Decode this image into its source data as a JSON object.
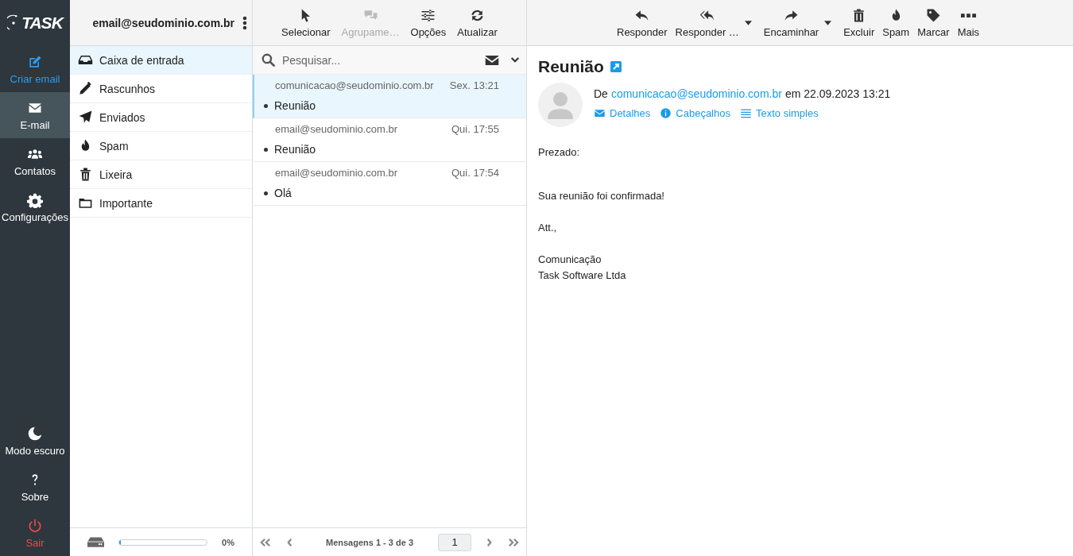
{
  "logo": "TASK",
  "nav": {
    "top": [
      {
        "kind": "compose",
        "label": "Criar email",
        "selected": false
      },
      {
        "kind": "mail",
        "label": "E-mail",
        "selected": true
      },
      {
        "kind": "contacts",
        "label": "Contatos",
        "selected": false
      },
      {
        "kind": "settings",
        "label": "Configurações",
        "selected": false
      }
    ],
    "bottom": [
      {
        "kind": "darkmode",
        "label": "Modo escuro",
        "selected": false
      },
      {
        "kind": "about",
        "label": "Sobre",
        "selected": false
      },
      {
        "kind": "logout",
        "label": "Sair",
        "selected": false
      }
    ]
  },
  "account": "email@seudominio.com.br",
  "folders": [
    {
      "kind": "inbox",
      "label": "Caixa de entrada",
      "selected": true
    },
    {
      "kind": "drafts",
      "label": "Rascunhos",
      "selected": false
    },
    {
      "kind": "sent",
      "label": "Enviados",
      "selected": false
    },
    {
      "kind": "spam",
      "label": "Spam",
      "selected": false
    },
    {
      "kind": "trash",
      "label": "Lixeira",
      "selected": false
    },
    {
      "kind": "folder",
      "label": "Importante",
      "selected": false
    }
  ],
  "quota": {
    "level": 0,
    "reading": "0%"
  },
  "list_toolbar": [
    {
      "kind": "select",
      "label": "Selecionar",
      "disabled": false
    },
    {
      "kind": "group",
      "label": "Agrupame…",
      "disabled": true
    },
    {
      "kind": "options",
      "label": "Opções",
      "disabled": false
    },
    {
      "kind": "refresh",
      "label": "Atualizar",
      "disabled": false
    }
  ],
  "search": {
    "placeholder": "Pesquisar..."
  },
  "messages": [
    {
      "from": "comunicacao@seudominio.com.br",
      "date": "Sex. 13:21",
      "subject": "Reunião",
      "unread": true,
      "selected": true
    },
    {
      "from": "email@seudominio.com.br",
      "date": "Qui. 17:55",
      "subject": "Reunião",
      "unread": true,
      "selected": false
    },
    {
      "from": "email@seudominio.com.br",
      "date": "Qui. 17:54",
      "subject": "Olá",
      "unread": true,
      "selected": false
    }
  ],
  "pagination": {
    "summary": "Mensagens 1 - 3 de 3",
    "page": "1"
  },
  "reader_toolbar": [
    {
      "kind": "reply",
      "label": "Responder",
      "dropdown": false
    },
    {
      "kind": "reply-all",
      "label": "Responder …",
      "dropdown": true
    },
    {
      "kind": "forward",
      "label": "Encaminhar",
      "dropdown": true
    },
    {
      "kind": "delete",
      "label": "Excluir",
      "dropdown": false
    },
    {
      "kind": "spam",
      "label": "Spam",
      "dropdown": false
    },
    {
      "kind": "tag",
      "label": "Marcar",
      "dropdown": false
    },
    {
      "kind": "more",
      "label": "Mais",
      "dropdown": false
    }
  ],
  "message": {
    "subject": "Reunião",
    "from_label": "De",
    "from": "comunicacao@seudominio.com.br",
    "date_text": "em 22.09.2023 13:21",
    "actions": [
      {
        "kind": "details",
        "label": "Detalhes"
      },
      {
        "kind": "headers",
        "label": "Cabeçalhos"
      },
      {
        "kind": "plain",
        "label": "Texto simples"
      }
    ],
    "body": [
      [
        "Prezado:"
      ],
      [
        "Sua reunião foi confirmada!"
      ],
      [
        "Att.,"
      ],
      [
        "Comunicação",
        "Task Software Ltda"
      ]
    ]
  }
}
